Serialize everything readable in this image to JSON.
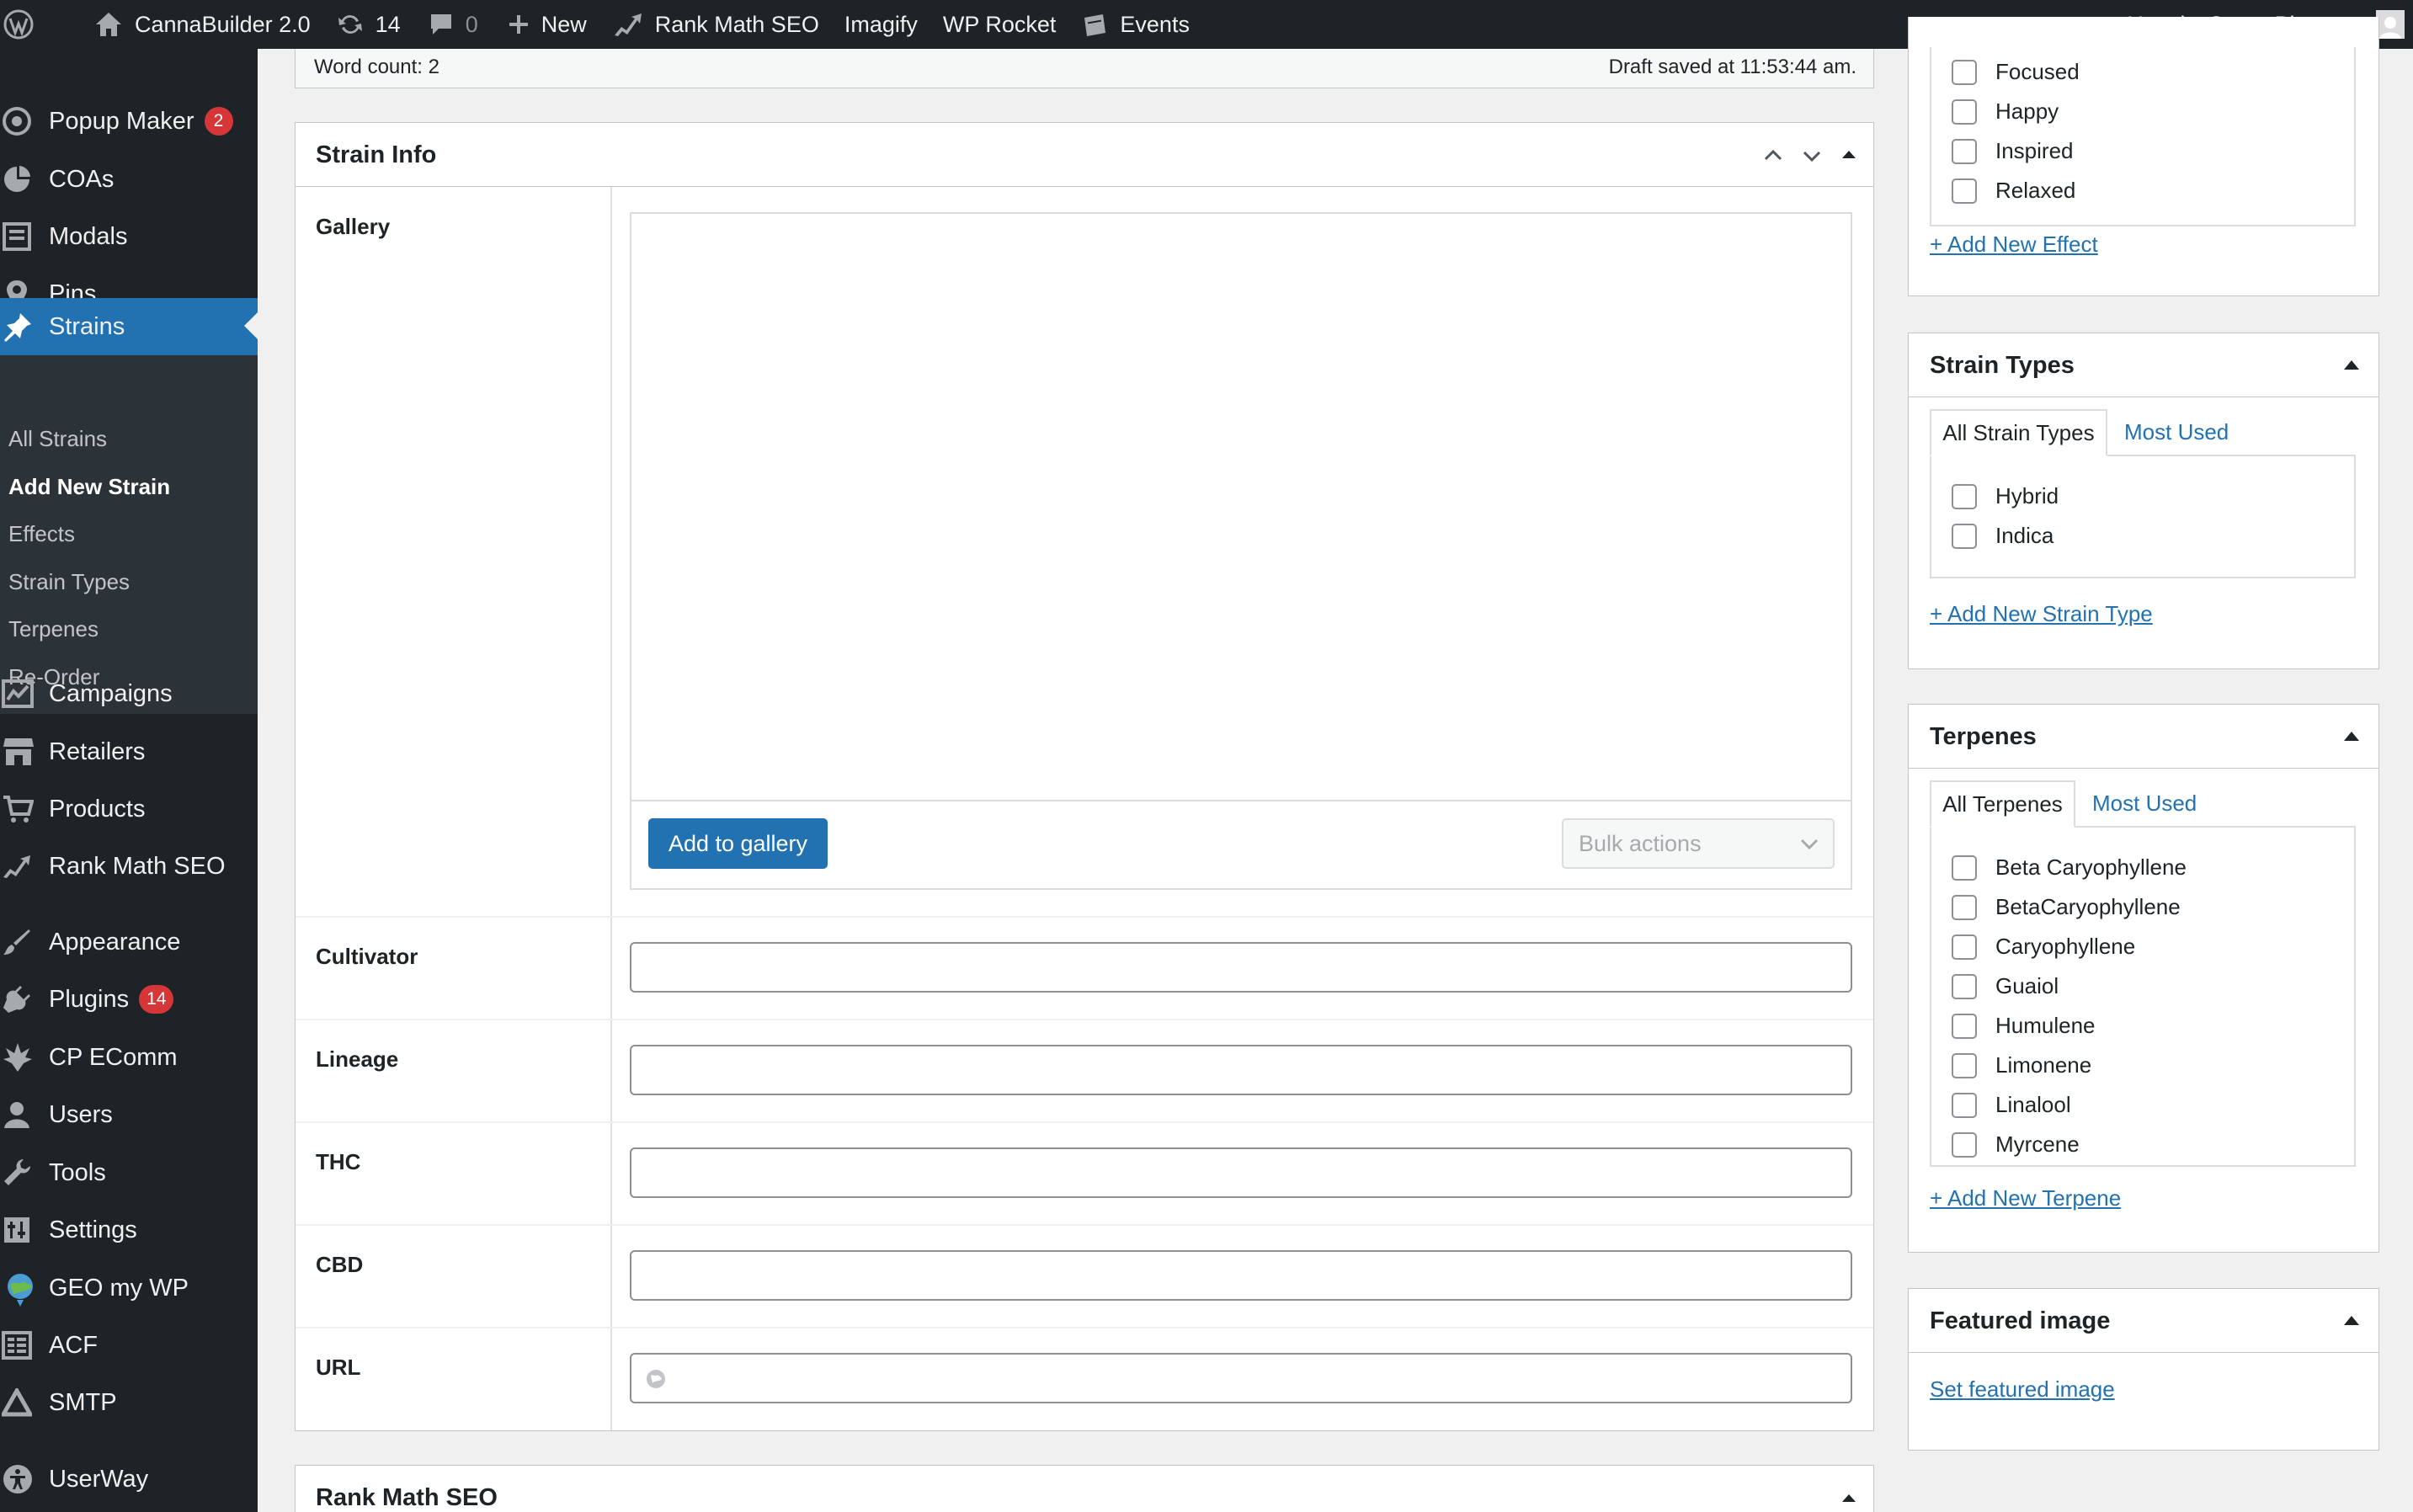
{
  "adminbar": {
    "site_name": "CannaBuilder 2.0",
    "updates_count": "14",
    "comments_count": "0",
    "new_label": "New",
    "rank_math_label": "Rank Math SEO",
    "imagify_label": "Imagify",
    "wp_rocket_label": "WP Rocket",
    "events_label": "Events",
    "howdy": "Howdy, CannaPlanners"
  },
  "sidebar": {
    "popup_maker": "Popup Maker",
    "popup_maker_badge": "2",
    "coas": "COAs",
    "modals": "Modals",
    "pins": "Pins",
    "strains": "Strains",
    "submenu": {
      "all_strains": "All Strains",
      "add_new_strain": "Add New Strain",
      "effects": "Effects",
      "strain_types": "Strain Types",
      "terpenes": "Terpenes",
      "re_order": "Re-Order"
    },
    "campaigns": "Campaigns",
    "retailers": "Retailers",
    "products": "Products",
    "rank_math_seo": "Rank Math SEO",
    "appearance": "Appearance",
    "plugins": "Plugins",
    "plugins_badge": "14",
    "cp_ecomm": "CP EComm",
    "users": "Users",
    "tools": "Tools",
    "settings": "Settings",
    "geo_my_wp": "GEO my WP",
    "acf": "ACF",
    "smtp": "SMTP",
    "userway": "UserWay"
  },
  "editor": {
    "word_count": "Word count: 2",
    "draft_saved": "Draft saved at 11:53:44 am."
  },
  "strain_info": {
    "title": "Strain Info",
    "gallery_label": "Gallery",
    "add_to_gallery": "Add to gallery",
    "bulk_actions": "Bulk actions",
    "cultivator_label": "Cultivator",
    "lineage_label": "Lineage",
    "thc_label": "THC",
    "cbd_label": "CBD",
    "url_label": "URL",
    "cultivator_value": "",
    "lineage_value": "",
    "thc_value": "",
    "cbd_value": "",
    "url_value": ""
  },
  "rank_math_box": {
    "title": "Rank Math SEO"
  },
  "effects_box": {
    "items": [
      "Focused",
      "Happy",
      "Inspired",
      "Relaxed"
    ],
    "add_new": "+ Add New Effect"
  },
  "strain_types_box": {
    "title": "Strain Types",
    "tab_all": "All Strain Types",
    "tab_most_used": "Most Used",
    "items": [
      "Hybrid",
      "Indica"
    ],
    "add_new": "+ Add New Strain Type"
  },
  "terpenes_box": {
    "title": "Terpenes",
    "tab_all": "All Terpenes",
    "tab_most_used": "Most Used",
    "items": [
      "Beta Caryophyllene",
      "BetaCaryophyllene",
      "Caryophyllene",
      "Guaiol",
      "Humulene",
      "Limonene",
      "Linalool",
      "Myrcene"
    ],
    "add_new": "+ Add New Terpene"
  },
  "featured_image_box": {
    "title": "Featured image",
    "set_link": "Set featured image"
  },
  "colors": {
    "admin_dark": "#1d2327",
    "submenu_bg": "#2c3338",
    "accent_blue": "#2271b1",
    "badge_red": "#d63638",
    "page_bg": "#f0f0f1"
  }
}
